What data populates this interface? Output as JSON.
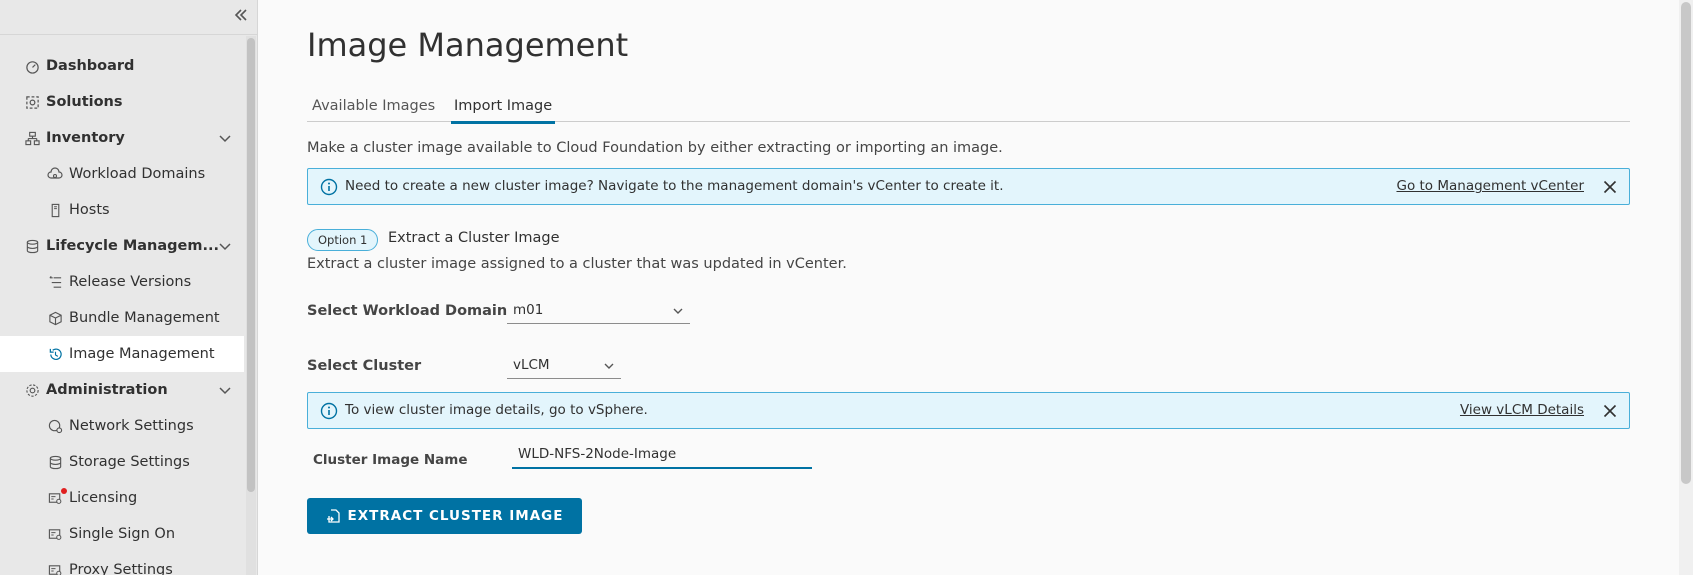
{
  "sidebar": {
    "items": [
      {
        "label": "Dashboard",
        "icon": "dashboard-icon"
      },
      {
        "label": "Solutions",
        "icon": "solutions-icon"
      },
      {
        "label": "Inventory",
        "icon": "inventory-icon",
        "expanded": true
      },
      {
        "label": "Workload Domains",
        "icon": "workload-domains-icon"
      },
      {
        "label": "Hosts",
        "icon": "hosts-icon"
      },
      {
        "label": "Lifecycle Managem...",
        "icon": "lifecycle-icon",
        "expanded": true
      },
      {
        "label": "Release Versions",
        "icon": "release-versions-icon"
      },
      {
        "label": "Bundle Management",
        "icon": "bundle-icon"
      },
      {
        "label": "Image Management",
        "icon": "image-management-icon",
        "active": true
      },
      {
        "label": "Administration",
        "icon": "administration-icon",
        "expanded": true
      },
      {
        "label": "Network Settings",
        "icon": "network-icon"
      },
      {
        "label": "Storage Settings",
        "icon": "storage-icon"
      },
      {
        "label": "Licensing",
        "icon": "licensing-icon"
      },
      {
        "label": "Single Sign On",
        "icon": "sso-icon"
      },
      {
        "label": "Proxy Settings",
        "icon": "proxy-icon"
      }
    ]
  },
  "main": {
    "title": "Image Management",
    "tabs": [
      {
        "label": "Available Images"
      },
      {
        "label": "Import Image",
        "active": true
      }
    ],
    "description": "Make a cluster image available to Cloud Foundation by either extracting or importing an image.",
    "alert1": {
      "text": "Need to create a new cluster image? Navigate to the management domain's vCenter to create it.",
      "link": "Go to Management vCenter"
    },
    "option": {
      "badge": "Option 1",
      "title": "Extract a Cluster Image",
      "description": "Extract a cluster image assigned to a cluster that was updated in vCenter."
    },
    "workload_domain": {
      "label": "Select Workload Domain",
      "value": "m01"
    },
    "cluster": {
      "label": "Select Cluster",
      "value": "vLCM"
    },
    "alert2": {
      "text": "To view cluster image details, go to vSphere.",
      "link": "View vLCM Details"
    },
    "image_name": {
      "label": "Cluster Image Name",
      "value": "WLD-NFS-2Node-Image"
    },
    "extract_button": "EXTRACT CLUSTER IMAGE"
  },
  "colors": {
    "accent": "#0072a3",
    "alert_bg": "#e3f5fc",
    "alert_border": "#49afd9",
    "notification": "#e02020"
  }
}
